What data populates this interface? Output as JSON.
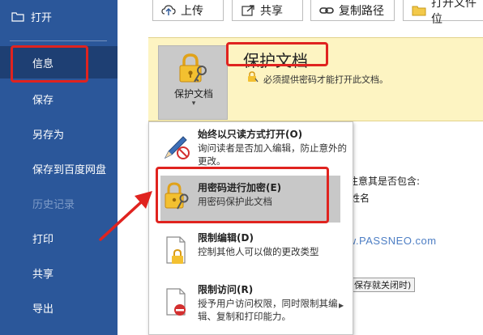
{
  "sidebar": {
    "open_label": "打开",
    "items": [
      {
        "label": "信息",
        "state": "active"
      },
      {
        "label": "保存",
        "state": "normal"
      },
      {
        "label": "另存为",
        "state": "normal"
      },
      {
        "label": "保存到百度网盘",
        "state": "normal"
      },
      {
        "label": "历史记录",
        "state": "disabled"
      },
      {
        "label": "打印",
        "state": "normal"
      },
      {
        "label": "共享",
        "state": "normal"
      },
      {
        "label": "导出",
        "state": "normal"
      }
    ]
  },
  "toolbar": {
    "upload_label": "上传",
    "share_label": "共享",
    "copy_path_label": "复制路径",
    "open_location_label": "打开文件位"
  },
  "protect": {
    "button_label": "保护文档",
    "title": "保护文档",
    "description": "必须提供密码才能打开此文档。"
  },
  "menu": {
    "items": [
      {
        "title": "始终以只读方式打开(O)",
        "desc": "询问读者是否加入编辑，防止意外的更改。"
      },
      {
        "title": "用密码进行加密(E)",
        "desc": "用密码保护此文档"
      },
      {
        "title": "限制编辑(D)",
        "desc": "控制其他人可以做的更改类型"
      },
      {
        "title": "限制访问(R)",
        "desc": "授予用户访问权限，同时限制其编辑、复制和打印能力。"
      }
    ]
  },
  "background": {
    "text_1": "注意其是否包含:",
    "text_2": "姓名",
    "button_text": "保存就关闭时)"
  },
  "watermark": "www.PASSNEO.com",
  "colors": {
    "sidebar_bg": "#2b579a",
    "sidebar_active": "#1e3f73",
    "panel_bg": "#fdf4c2",
    "highlight_red": "#e0231f",
    "selected_bg": "#c8c8c8"
  }
}
